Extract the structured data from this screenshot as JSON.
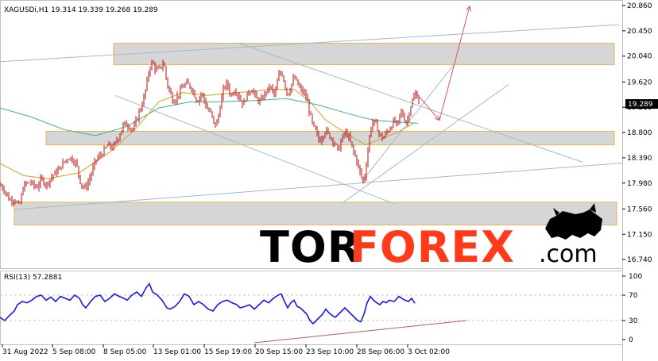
{
  "chart_data": [
    {
      "type": "candlestick",
      "symbol_header": "XAGUSDi,H1  19.314 19.339 19.268 19.289",
      "current_price": 19.289,
      "current_price_label": "19.289",
      "ylim": [
        16.6,
        20.95
      ],
      "yticks": [
        "20.860",
        "20.450",
        "20.040",
        "19.620",
        "19.210",
        "18.800",
        "18.390",
        "17.980",
        "17.560",
        "17.150",
        "16.740"
      ],
      "xticks": [
        "31 Aug 2022",
        "5 Sep 08:00",
        "8 Sep 05:00",
        "13 Sep 01:00",
        "15 Sep 19:00",
        "20 Sep 15:00",
        "23 Sep 10:00",
        "28 Sep 06:00",
        "3 Oct 02:00"
      ],
      "price_path": [
        [
          0,
          17.95
        ],
        [
          6,
          17.86
        ],
        [
          12,
          17.7
        ],
        [
          18,
          17.72
        ],
        [
          24,
          17.6
        ],
        [
          30,
          17.95
        ],
        [
          38,
          18.0
        ],
        [
          46,
          17.9
        ],
        [
          52,
          18.05
        ],
        [
          58,
          17.95
        ],
        [
          66,
          18.1
        ],
        [
          74,
          18.2
        ],
        [
          82,
          18.35
        ],
        [
          88,
          18.4
        ],
        [
          96,
          18.3
        ],
        [
          102,
          17.95
        ],
        [
          108,
          17.9
        ],
        [
          114,
          18.1
        ],
        [
          120,
          18.35
        ],
        [
          128,
          18.45
        ],
        [
          136,
          18.6
        ],
        [
          142,
          18.55
        ],
        [
          150,
          18.75
        ],
        [
          156,
          18.95
        ],
        [
          162,
          18.9
        ],
        [
          168,
          18.85
        ],
        [
          174,
          19.1
        ],
        [
          180,
          19.3
        ],
        [
          184,
          19.55
        ],
        [
          188,
          19.85
        ],
        [
          192,
          19.95
        ],
        [
          196,
          19.8
        ],
        [
          202,
          19.85
        ],
        [
          206,
          19.95
        ],
        [
          210,
          19.6
        ],
        [
          214,
          19.45
        ],
        [
          218,
          19.3
        ],
        [
          224,
          19.4
        ],
        [
          230,
          19.55
        ],
        [
          236,
          19.6
        ],
        [
          242,
          19.5
        ],
        [
          248,
          19.3
        ],
        [
          254,
          19.45
        ],
        [
          260,
          19.2
        ],
        [
          266,
          19.1
        ],
        [
          270,
          18.9
        ],
        [
          274,
          19.0
        ],
        [
          278,
          19.3
        ],
        [
          282,
          19.55
        ],
        [
          286,
          19.6
        ],
        [
          290,
          19.4
        ],
        [
          296,
          19.5
        ],
        [
          302,
          19.35
        ],
        [
          306,
          19.25
        ],
        [
          312,
          19.45
        ],
        [
          318,
          19.5
        ],
        [
          322,
          19.35
        ],
        [
          328,
          19.3
        ],
        [
          334,
          19.45
        ],
        [
          340,
          19.55
        ],
        [
          346,
          19.4
        ],
        [
          350,
          19.7
        ],
        [
          354,
          19.8
        ],
        [
          358,
          19.6
        ],
        [
          362,
          19.4
        ],
        [
          366,
          19.55
        ],
        [
          370,
          19.7
        ],
        [
          374,
          19.6
        ],
        [
          378,
          19.5
        ],
        [
          382,
          19.45
        ],
        [
          386,
          19.35
        ],
        [
          390,
          19.1
        ],
        [
          394,
          18.9
        ],
        [
          398,
          18.8
        ],
        [
          402,
          18.65
        ],
        [
          406,
          18.75
        ],
        [
          410,
          18.85
        ],
        [
          414,
          18.75
        ],
        [
          418,
          18.7
        ],
        [
          422,
          18.6
        ],
        [
          426,
          18.5
        ],
        [
          430,
          18.7
        ],
        [
          434,
          18.8
        ],
        [
          438,
          18.75
        ],
        [
          442,
          18.6
        ],
        [
          446,
          18.45
        ],
        [
          450,
          18.3
        ],
        [
          454,
          18.1
        ],
        [
          458,
          18.0
        ],
        [
          462,
          18.4
        ],
        [
          466,
          18.85
        ],
        [
          470,
          19.0
        ],
        [
          474,
          18.9
        ],
        [
          478,
          18.75
        ],
        [
          482,
          18.7
        ],
        [
          486,
          18.8
        ],
        [
          490,
          18.85
        ],
        [
          496,
          19.0
        ],
        [
          500,
          18.9
        ],
        [
          504,
          19.15
        ],
        [
          508,
          19.05
        ],
        [
          512,
          18.95
        ],
        [
          516,
          19.2
        ],
        [
          520,
          19.35
        ],
        [
          524,
          19.45
        ],
        [
          527,
          19.29
        ]
      ],
      "ema_slow": [
        [
          0,
          19.2
        ],
        [
          40,
          19.05
        ],
        [
          80,
          18.85
        ],
        [
          120,
          18.75
        ],
        [
          160,
          18.9
        ],
        [
          200,
          19.2
        ],
        [
          240,
          19.3
        ],
        [
          280,
          19.3
        ],
        [
          320,
          19.32
        ],
        [
          360,
          19.35
        ],
        [
          400,
          19.25
        ],
        [
          440,
          19.1
        ],
        [
          470,
          19.0
        ],
        [
          500,
          18.97
        ],
        [
          526,
          18.95
        ]
      ],
      "ema_fast": [
        [
          0,
          18.3
        ],
        [
          30,
          18.1
        ],
        [
          60,
          18.05
        ],
        [
          100,
          18.15
        ],
        [
          140,
          18.5
        ],
        [
          170,
          18.85
        ],
        [
          200,
          19.3
        ],
        [
          230,
          19.45
        ],
        [
          260,
          19.4
        ],
        [
          300,
          19.45
        ],
        [
          340,
          19.5
        ],
        [
          370,
          19.5
        ],
        [
          390,
          19.3
        ],
        [
          410,
          19.0
        ],
        [
          440,
          18.75
        ],
        [
          460,
          18.6
        ],
        [
          480,
          18.7
        ],
        [
          500,
          18.8
        ],
        [
          520,
          18.95
        ]
      ],
      "zones": [
        {
          "x0": 143,
          "x1": 773,
          "y0": 19.9,
          "y1": 20.25
        },
        {
          "x0": 58,
          "x1": 773,
          "y0": 18.6,
          "y1": 18.82
        },
        {
          "x0": 18,
          "x1": 776,
          "y0": 17.3,
          "y1": 17.67
        }
      ],
      "trendlines": [
        {
          "x0": 0,
          "y0": 19.95,
          "x1": 779,
          "y1": 20.55
        },
        {
          "x0": 18,
          "y0": 17.55,
          "x1": 828,
          "y1": 18.35
        },
        {
          "x0": 300,
          "y0": 20.25,
          "x1": 733,
          "y1": 18.32
        },
        {
          "x0": 145,
          "y0": 19.4,
          "x1": 495,
          "y1": 17.65
        },
        {
          "x0": 430,
          "y0": 17.65,
          "x1": 640,
          "y1": 19.58
        },
        {
          "x0": 455,
          "y0": 18.0,
          "x1": 574,
          "y1": 19.95
        }
      ],
      "arrows": [
        {
          "x0": 523,
          "y0": 19.45,
          "x1": 553,
          "y1": 19.0
        },
        {
          "x0": 553,
          "y0": 19.0,
          "x1": 591,
          "y1": 20.85
        }
      ]
    },
    {
      "type": "line",
      "header": "RSI(13) 57.2881",
      "ylim": [
        0,
        100
      ],
      "yticks": [
        "100",
        "70",
        "30",
        "0"
      ],
      "levels": [
        70,
        30
      ],
      "rsi_path": [
        [
          0,
          35
        ],
        [
          6,
          30
        ],
        [
          12,
          38
        ],
        [
          18,
          45
        ],
        [
          22,
          55
        ],
        [
          28,
          60
        ],
        [
          34,
          58
        ],
        [
          40,
          62
        ],
        [
          46,
          68
        ],
        [
          52,
          70
        ],
        [
          58,
          62
        ],
        [
          64,
          67
        ],
        [
          70,
          60
        ],
        [
          76,
          68
        ],
        [
          82,
          65
        ],
        [
          88,
          62
        ],
        [
          94,
          70
        ],
        [
          100,
          65
        ],
        [
          104,
          55
        ],
        [
          108,
          50
        ],
        [
          114,
          60
        ],
        [
          120,
          68
        ],
        [
          126,
          70
        ],
        [
          132,
          60
        ],
        [
          138,
          65
        ],
        [
          144,
          72
        ],
        [
          150,
          68
        ],
        [
          156,
          65
        ],
        [
          160,
          62
        ],
        [
          166,
          70
        ],
        [
          172,
          75
        ],
        [
          178,
          68
        ],
        [
          184,
          82
        ],
        [
          188,
          88
        ],
        [
          192,
          75
        ],
        [
          198,
          70
        ],
        [
          204,
          62
        ],
        [
          210,
          50
        ],
        [
          214,
          48
        ],
        [
          220,
          52
        ],
        [
          226,
          60
        ],
        [
          232,
          72
        ],
        [
          238,
          68
        ],
        [
          244,
          55
        ],
        [
          250,
          60
        ],
        [
          256,
          55
        ],
        [
          262,
          48
        ],
        [
          268,
          45
        ],
        [
          274,
          55
        ],
        [
          280,
          60
        ],
        [
          286,
          62
        ],
        [
          292,
          58
        ],
        [
          298,
          55
        ],
        [
          302,
          50
        ],
        [
          308,
          52
        ],
        [
          314,
          55
        ],
        [
          320,
          48
        ],
        [
          326,
          55
        ],
        [
          332,
          62
        ],
        [
          338,
          58
        ],
        [
          344,
          65
        ],
        [
          350,
          70
        ],
        [
          354,
          72
        ],
        [
          358,
          60
        ],
        [
          362,
          50
        ],
        [
          366,
          58
        ],
        [
          370,
          62
        ],
        [
          374,
          52
        ],
        [
          378,
          50
        ],
        [
          382,
          45
        ],
        [
          386,
          40
        ],
        [
          390,
          30
        ],
        [
          394,
          25
        ],
        [
          398,
          30
        ],
        [
          402,
          35
        ],
        [
          406,
          40
        ],
        [
          410,
          48
        ],
        [
          414,
          42
        ],
        [
          418,
          38
        ],
        [
          422,
          35
        ],
        [
          426,
          40
        ],
        [
          430,
          45
        ],
        [
          434,
          50
        ],
        [
          438,
          45
        ],
        [
          442,
          40
        ],
        [
          446,
          35
        ],
        [
          450,
          30
        ],
        [
          454,
          28
        ],
        [
          458,
          40
        ],
        [
          462,
          58
        ],
        [
          466,
          68
        ],
        [
          470,
          62
        ],
        [
          474,
          58
        ],
        [
          478,
          55
        ],
        [
          482,
          60
        ],
        [
          486,
          58
        ],
        [
          490,
          62
        ],
        [
          496,
          60
        ],
        [
          502,
          68
        ],
        [
          508,
          63
        ],
        [
          514,
          60
        ],
        [
          518,
          65
        ],
        [
          522,
          57.29
        ]
      ],
      "support_line": {
        "x0": 320,
        "y0": -5,
        "x1": 587,
        "y1": 30
      },
      "arrows": [
        {
          "x0": 530,
          "y0": 55,
          "x1": 549,
          "y1": 27
        },
        {
          "x0": 549,
          "y0": 27,
          "x1": 567,
          "y1": 100
        }
      ]
    }
  ],
  "watermark": {
    "part1": "TOR",
    "part2": "FOREX",
    "suffix": ".com"
  },
  "colors": {
    "candles": "#b01010",
    "ema_slow": "#3cb48c",
    "ema_fast": "#d4a020",
    "zone_fill": "#d6d6d6",
    "zone_border": "#e8b450",
    "trendline": "#a9b8c6",
    "arrow": "#e05555",
    "rsi": "#1a1ae6",
    "rsi_support": "#b06060",
    "price_tag_bg": "#000000",
    "watermark_dark": "#000000",
    "watermark_accent": "#ff3b1a",
    "border": "#c0c0c0"
  }
}
